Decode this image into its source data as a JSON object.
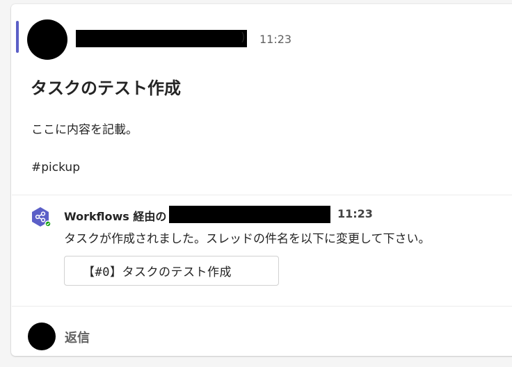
{
  "post": {
    "accent_color": "#5b5fc7",
    "sender_suffix": ")",
    "time": "11:23",
    "subject": "タスクのテスト作成",
    "body": "ここに内容を記載。",
    "hashtag": "#pickup"
  },
  "reply_message": {
    "icon": "workflows-icon",
    "sender_prefix": "Workflows 経由の",
    "time": "11:23",
    "text": "タスクが作成されました。スレッドの件名を以下に変更して下さい。",
    "suggested_title": "【#0】タスクのテスト作成"
  },
  "composer": {
    "reply_label": "返信"
  }
}
